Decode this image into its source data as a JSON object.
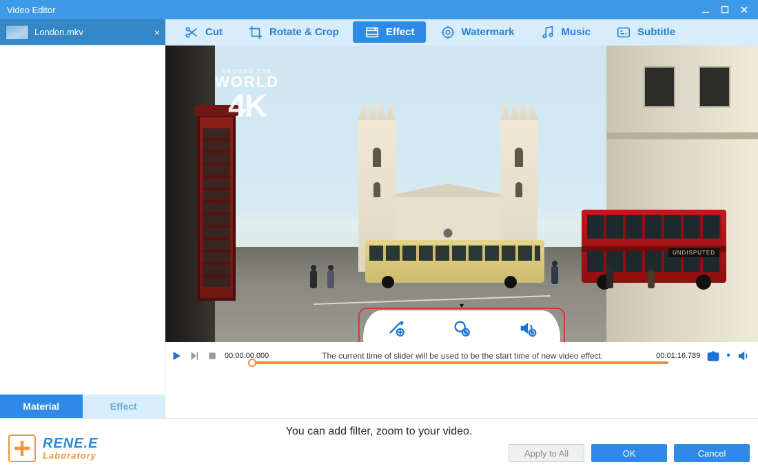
{
  "window": {
    "title": "Video Editor"
  },
  "file": {
    "name": "London.mkv"
  },
  "toolbar": {
    "cut": "Cut",
    "rotate": "Rotate & Crop",
    "effect": "Effect",
    "watermark": "Watermark",
    "music": "Music",
    "subtitle": "Subtitle",
    "active": "effect"
  },
  "sidebar": {
    "tabs": {
      "material": "Material",
      "effect": "Effect",
      "active": "material"
    }
  },
  "preview": {
    "watermark_line1": "AROUND THE",
    "watermark_line2": "WORLD",
    "watermark_line3": "4K",
    "bus_ad": "UNDISPUTED"
  },
  "timeline": {
    "current": "00:00:00.000",
    "duration": "00:01:16.789",
    "hint": "The current time of slider will be used to be the start time of new video effect."
  },
  "footer": {
    "message": "You can add filter, zoom to your video.",
    "brand_line1": "RENE.E",
    "brand_line2": "Laboratory",
    "apply_all": "Apply to All",
    "ok": "OK",
    "cancel": "Cancel"
  }
}
